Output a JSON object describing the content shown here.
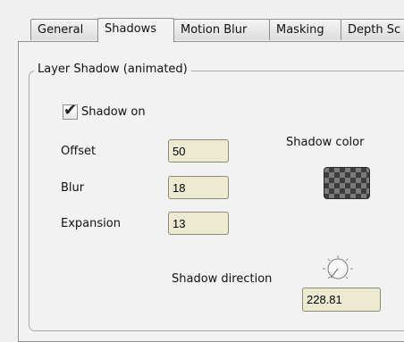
{
  "tabs": [
    {
      "label": "General"
    },
    {
      "label": "Shadows"
    },
    {
      "label": "Motion Blur"
    },
    {
      "label": "Masking"
    },
    {
      "label": "Depth Sc"
    }
  ],
  "group": {
    "title": "Layer Shadow (animated)"
  },
  "shadow_on": {
    "label": "Shadow on",
    "checked": true
  },
  "offset": {
    "label": "Offset",
    "value": "50"
  },
  "blur": {
    "label": "Blur",
    "value": "18"
  },
  "expansion": {
    "label": "Expansion",
    "value": "13"
  },
  "shadow_color": {
    "label": "Shadow color",
    "swatch_icon": "checkerboard-transparent-swatch"
  },
  "shadow_direction": {
    "label": "Shadow direction",
    "value": "228.81",
    "dial_icon": "angle-dial-icon"
  },
  "colors": {
    "field_bg": "#ecebd2",
    "panel_bg": "#f2f2f2",
    "border": "#8f8f8f"
  }
}
